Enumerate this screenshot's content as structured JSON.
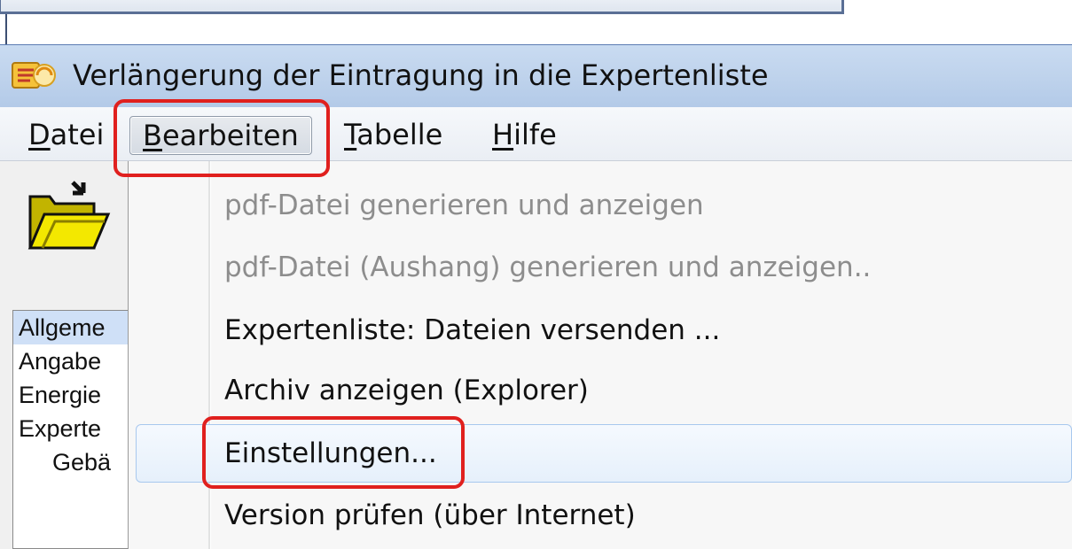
{
  "window": {
    "title": "Verlängerung der Eintragung in die Expertenliste"
  },
  "menubar": {
    "datei": {
      "pre": "",
      "ul": "D",
      "post": "atei"
    },
    "bearbeiten": {
      "pre": "",
      "ul": "B",
      "post": "earbeiten"
    },
    "tabelle": {
      "pre": "",
      "ul": "T",
      "post": "abelle"
    },
    "hilfe": {
      "pre": "",
      "ul": "H",
      "post": "ilfe"
    }
  },
  "sidebar": {
    "items": [
      {
        "label": "Allgeme"
      },
      {
        "label": "Angabe"
      },
      {
        "label": "Energie"
      },
      {
        "label": "Experte"
      },
      {
        "label": "Gebä"
      }
    ]
  },
  "dropdown": {
    "items": [
      {
        "label": "pdf-Datei generieren und anzeigen",
        "enabled": false
      },
      {
        "label": "pdf-Datei (Aushang) generieren und anzeigen..",
        "enabled": false
      },
      {
        "label": "Expertenliste: Dateien versenden ...",
        "enabled": true
      },
      {
        "label": "Archiv anzeigen (Explorer)",
        "enabled": true
      },
      {
        "label": "Einstellungen...",
        "enabled": true
      },
      {
        "label": "Version prüfen (über Internet)",
        "enabled": true
      }
    ]
  },
  "colors": {
    "highlight_box": "#e0201e",
    "titlebar": "#bfd3ec",
    "disabled_text": "#8d8d8d"
  }
}
